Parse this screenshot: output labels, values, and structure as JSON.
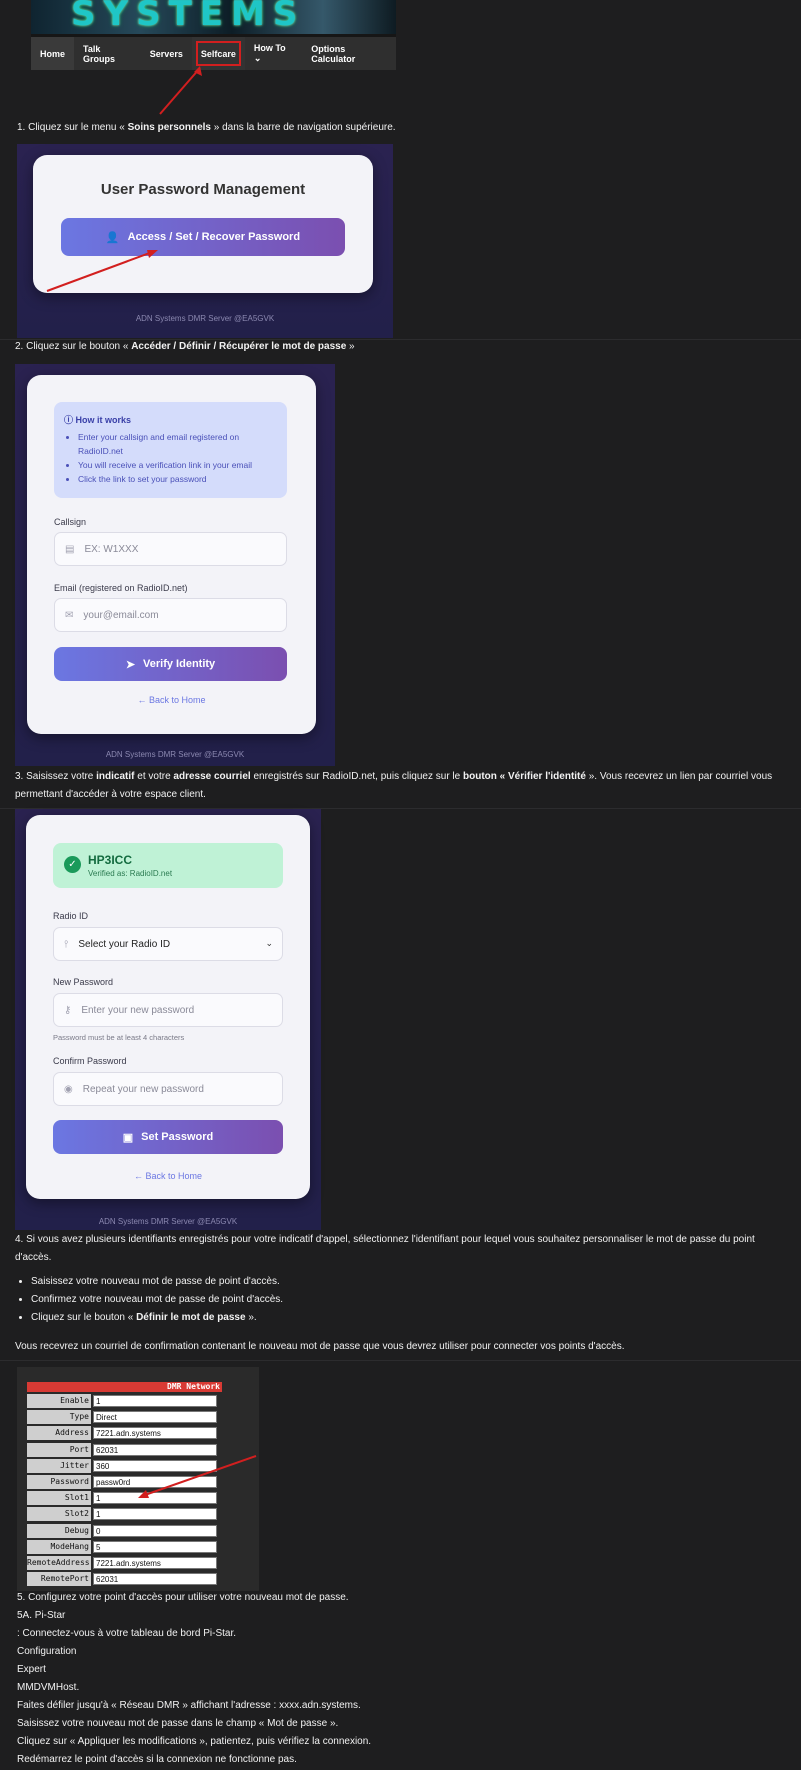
{
  "banner": {
    "logo_text": "SYSTEMS",
    "nav": [
      "Home",
      "Talk Groups",
      "Servers",
      "Selfcare",
      "How To ⌄",
      "Options Calculator"
    ]
  },
  "step1": {
    "prefix": "1. Cliquez sur le menu « ",
    "bold": "Soins personnels",
    "suffix": " » dans la barre de navigation supérieure."
  },
  "panel1": {
    "title": "User Password Management",
    "button": "Access / Set / Recover Password",
    "footer": "ADN Systems DMR Server @EA5GVK"
  },
  "step2": {
    "prefix": "2. Cliquez sur le bouton « ",
    "bold": "Accéder / Définir / Récupérer le mot de passe",
    "suffix": " »"
  },
  "panel2": {
    "how_title": "How it works",
    "how_items": [
      "Enter your callsign and email registered on RadioID.net",
      "You will receive a verification link in your email",
      "Click the link to set your password"
    ],
    "callsign_label": "Callsign",
    "callsign_placeholder": "EX: W1XXX",
    "email_label": "Email (registered on RadioID.net)",
    "email_placeholder": "your@email.com",
    "button": "Verify Identity",
    "back": "← Back to Home",
    "footer": "ADN Systems DMR Server @EA5GVK"
  },
  "step3": {
    "t1": "3. Saisissez votre ",
    "b1": "indicatif",
    "t2": " et votre ",
    "b2": "adresse courriel",
    "t3": " enregistrés sur RadioID.net, puis cliquez sur le ",
    "b3": "bouton « Vérifier l'identité",
    "t4": " ». Vous recevrez un lien par courriel vous",
    "line2": "permettant d'accéder à votre espace client."
  },
  "panel3": {
    "callsign": "HP3ICC",
    "verified": "Verified as: RadioID.net",
    "radio_label": "Radio ID",
    "radio_select": "Select your Radio ID",
    "new_label": "New Password",
    "new_placeholder": "Enter your new password",
    "hint": "Password must be at least 4 characters",
    "confirm_label": "Confirm Password",
    "confirm_placeholder": "Repeat your new password",
    "button": "Set Password",
    "back": "← Back to Home",
    "footer": "ADN Systems DMR Server @EA5GVK"
  },
  "step4": {
    "line1": "4. Si vous avez plusieurs identifiants enregistrés pour votre indicatif d'appel, sélectionnez l'identifiant pour lequel vous souhaitez personnaliser le mot de passe du point",
    "line2": "d'accès.",
    "bullets": [
      "Saisissez votre nouveau mot de passe de point d'accès.",
      "Confirmez votre nouveau mot de passe de point d'accès."
    ],
    "bullet3_prefix": "Cliquez sur le bouton « ",
    "bullet3_bold": "Définir le mot de passe",
    "bullet3_suffix": " ».",
    "confirm_text": "Vous recevrez un courriel de confirmation contenant le nouveau mot de passe que vous devrez utiliser pour connecter vos points d'accès."
  },
  "table": {
    "header": "DMR Network",
    "rows": [
      {
        "k": "Enable",
        "v": "1"
      },
      {
        "k": "Type",
        "v": "Direct"
      },
      {
        "k": "Address",
        "v": "7221.adn.systems"
      },
      {
        "k": "Port",
        "v": "62031"
      },
      {
        "k": "Jitter",
        "v": "360"
      },
      {
        "k": "Password",
        "v": "passw0rd"
      },
      {
        "k": "Slot1",
        "v": "1"
      },
      {
        "k": "Slot2",
        "v": "1"
      },
      {
        "k": "Debug",
        "v": "0"
      },
      {
        "k": "ModeHang",
        "v": "5"
      },
      {
        "k": "RemoteAddress",
        "v": "7221.adn.systems"
      },
      {
        "k": "RemotePort",
        "v": "62031"
      }
    ]
  },
  "step5": {
    "lines": [
      "5. Configurez votre point d'accès pour utiliser votre nouveau mot de passe.",
      "5A. Pi-Star",
      ": Connectez-vous à votre tableau de bord Pi-Star.",
      "Configuration",
      "Expert",
      "MMDVMHost.",
      "Faites défiler jusqu'à « Réseau DMR » affichant l'adresse : xxxx.adn.systems.",
      "Saisissez votre nouveau mot de passe dans le champ « Mot de passe ».",
      "Cliquez sur « Appliquer les modifications », patientez, puis vérifiez la connexion.",
      "Redémarrez le point d'accès si la connexion ne fonctionne pas."
    ]
  },
  "colors": {
    "background": "#1e1e1f",
    "accent": "#6b77e2",
    "purple": "#7b4fb0",
    "arrow": "#d21f1f"
  }
}
